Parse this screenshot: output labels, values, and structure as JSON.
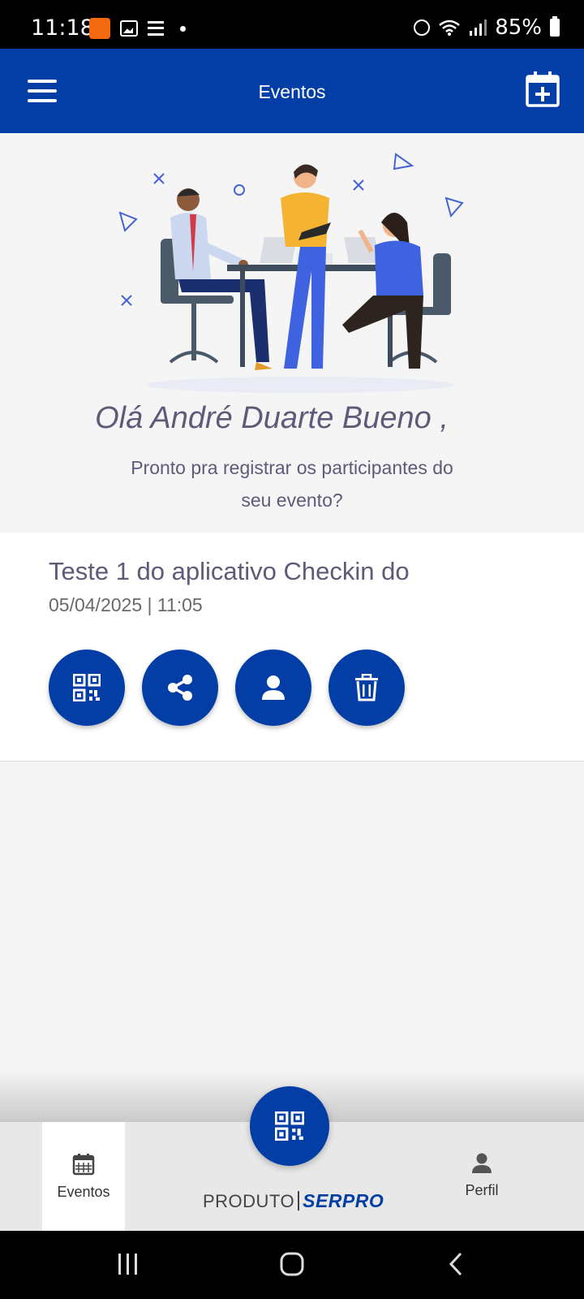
{
  "status": {
    "time": "11:18",
    "battery": "85%",
    "temu_label": "TEMU"
  },
  "header": {
    "title": "Eventos"
  },
  "hero": {
    "greeting": "Olá André Duarte Bueno ,",
    "subtitle": "Pronto pra registrar os participantes do seu evento?"
  },
  "event": {
    "title": "Teste 1 do aplicativo Checkin do",
    "date": "05/04/2025 | 11:05"
  },
  "nav": {
    "eventos_label": "Eventos",
    "perfil_label": "Perfil",
    "brand_prefix": "PRODUTO",
    "brand_name": "SERPRO"
  },
  "colors": {
    "primary": "#023ea6",
    "text": "#5d5b78"
  }
}
